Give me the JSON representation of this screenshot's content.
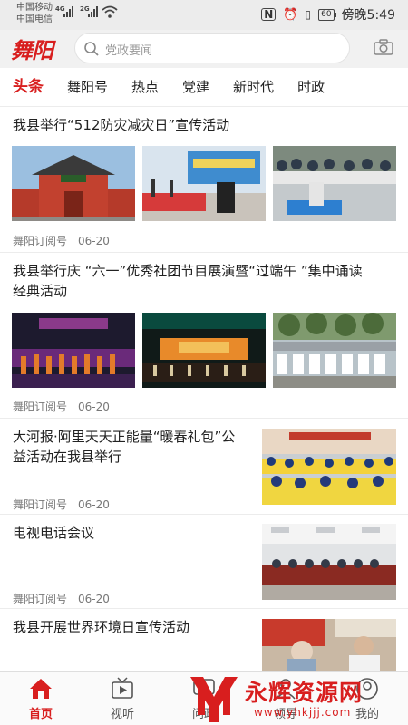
{
  "status_bar": {
    "carrier1": "中国移动",
    "carrier2": "中国电信",
    "net1": "4G",
    "net2": "2G",
    "battery": "60",
    "time": "傍晚5:49"
  },
  "header": {
    "logo": "舞阳",
    "search_placeholder": "党政要闻"
  },
  "tabs": [
    {
      "label": "头条",
      "active": true
    },
    {
      "label": "舞阳号"
    },
    {
      "label": "热点"
    },
    {
      "label": "党建"
    },
    {
      "label": "新时代"
    },
    {
      "label": "时政"
    }
  ],
  "articles": [
    {
      "title": "我县举行“512防灾减灾日”宣传活动",
      "source": "舞阳订阅号",
      "date": "06-20"
    },
    {
      "title_line1": "我县举行庆 “六一”优秀社团节目展演暨“过端午 ”集中诵读",
      "title_line2": "经典活动",
      "source": "舞阳订阅号",
      "date": "06-20"
    },
    {
      "title_line1": "大河报·阿里天天正能量“暖春礼包”公",
      "title_line2": "益活动在我县举行",
      "source": "舞阳订阅号",
      "date": "06-20"
    },
    {
      "title": "电视电话会议",
      "source": "舞阳订阅号",
      "date": "06-20"
    },
    {
      "title": "我县开展世界环境日宣传活动"
    }
  ],
  "bottom_nav": [
    {
      "label": "首页",
      "icon": "home-icon",
      "active": true
    },
    {
      "label": "视听",
      "icon": "tv-icon"
    },
    {
      "label": "问政",
      "icon": "chat-icon"
    },
    {
      "label": "领导",
      "icon": "user-icon"
    },
    {
      "label": "我的",
      "icon": "profile-icon"
    }
  ],
  "watermark": {
    "text": "永辉资源网",
    "url": "www.yhkjjj.com"
  },
  "colors": {
    "accent": "#d81e1e",
    "header_bg": "#f1f1f1",
    "status_bg": "#ececec"
  }
}
